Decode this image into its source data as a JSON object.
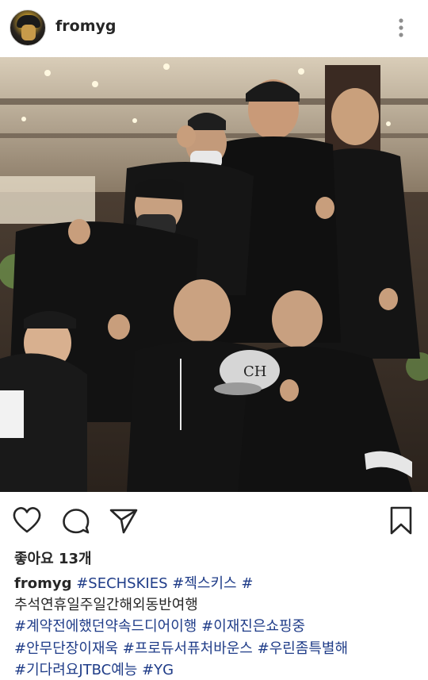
{
  "header": {
    "username": "fromyg",
    "avatar_icon": "profile-avatar",
    "more_icon": "more-vertical-icon"
  },
  "photo": {
    "alt": "group photo"
  },
  "actions": {
    "like_icon": "heart-icon",
    "comment_icon": "comment-icon",
    "share_icon": "send-icon",
    "save_icon": "bookmark-icon"
  },
  "likes": {
    "text": "좋아요 13개"
  },
  "caption": {
    "username": "fromyg",
    "line1_tags": [
      "#SECHSKIES",
      "#젝스키스",
      "#"
    ],
    "line2": "추석연휴일주일간해외동반여행",
    "line3_tags": [
      "#계약전에했던약속드디어이행",
      "#이재진은쇼핑중"
    ],
    "line4_tags": [
      "#안무단장이재욱",
      "#프로듀서퓨처바운스",
      "#우린좀특별해"
    ],
    "line5_tags": [
      "#기다려요JTBC예능",
      "#YG"
    ]
  },
  "colors": {
    "hashtag": "#1f3c88",
    "text": "#262626"
  }
}
